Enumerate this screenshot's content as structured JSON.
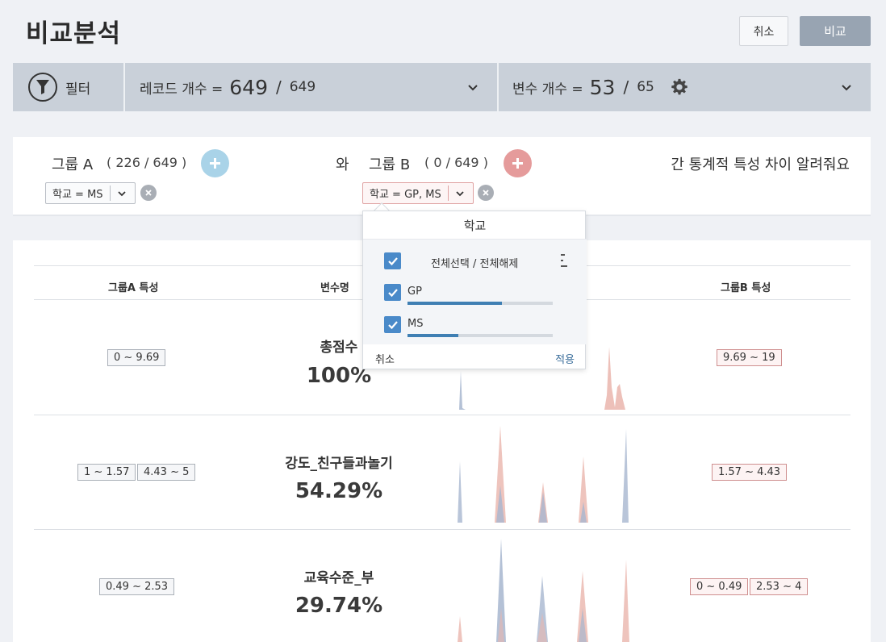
{
  "header": {
    "title": "비교분석",
    "cancel_label": "취소",
    "compare_label": "비교"
  },
  "filter_bar": {
    "filter_label": "필터",
    "record_label": "레코드 개수 =",
    "record_count": "649",
    "record_total": "649",
    "variable_label": "변수 개수 =",
    "variable_count": "53",
    "variable_total": "65",
    "separator": "/"
  },
  "groups": {
    "group_a_label": "그룹 A",
    "group_a_count": "( 226 / 649 )",
    "connector": "와",
    "group_b_label": "그룹 B",
    "group_b_count": "( 0 / 649 )",
    "suffix": "간 통계적 특성 차이 알려줘요",
    "chip_a": "학교 = MS",
    "chip_b": "학교 = GP, MS"
  },
  "table": {
    "col_group_a": "그룹A 특성",
    "col_variable": "변수명",
    "col_group_b": "그룹B 특성",
    "rows": [
      {
        "name": "총점수",
        "pct": "100%",
        "a_ranges": [
          "0 ~ 9.69"
        ],
        "b_ranges": [
          "9.69 ~ 19"
        ]
      },
      {
        "name": "강도_친구들과놀기",
        "pct": "54.29%",
        "a_ranges": [
          "1 ~ 1.57",
          "4.43 ~ 5"
        ],
        "b_ranges": [
          "1.57 ~ 4.43"
        ]
      },
      {
        "name": "교육수준_부",
        "pct": "29.74%",
        "a_ranges": [
          "0.49 ~ 2.53"
        ],
        "b_ranges": [
          "0 ~ 0.49",
          "2.53 ~ 4"
        ]
      }
    ]
  },
  "dropdown": {
    "title": "학교",
    "select_all": "전체선택 / 전체해제",
    "options": [
      {
        "label": "GP",
        "checked": true,
        "share": 0.65
      },
      {
        "label": "MS",
        "checked": true,
        "share": 0.35
      }
    ],
    "cancel_label": "취소",
    "apply_label": "적용"
  },
  "colors": {
    "group_a": "#a7b6cf",
    "group_b": "#eab5ad",
    "accent": "#4a8ac9",
    "add_a": "#a9d3e8",
    "add_b": "#e59b9b"
  }
}
